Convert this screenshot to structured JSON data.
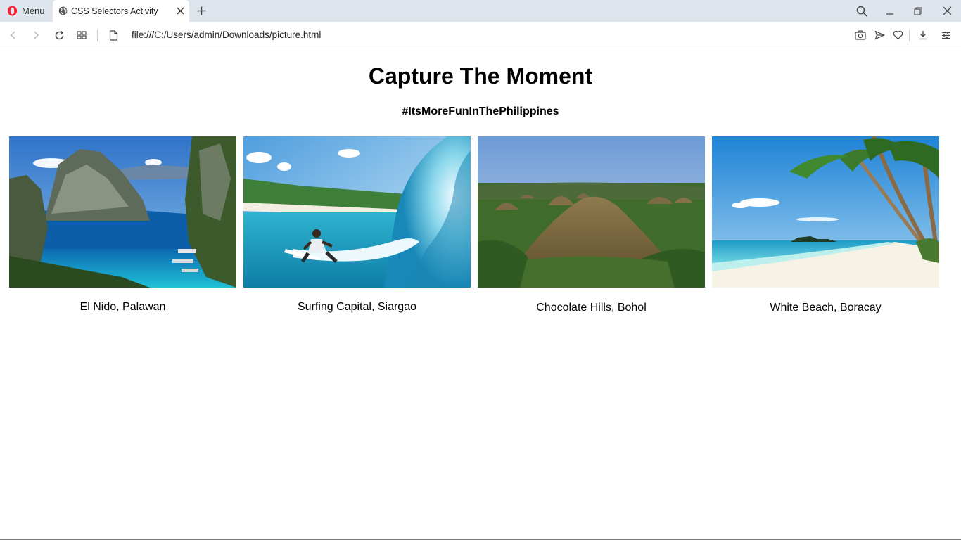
{
  "browser": {
    "menu_label": "Menu",
    "tab_title": "CSS Selectors Activity",
    "url": "file:///C:/Users/admin/Downloads/picture.html"
  },
  "page": {
    "title": "Capture The Moment",
    "subtitle": "#ItsMoreFunInThePhilippines",
    "gallery": [
      {
        "caption": "El Nido, Palawan"
      },
      {
        "caption": "Surfing Capital, Siargao"
      },
      {
        "caption": "Chocolate Hills, Bohol"
      },
      {
        "caption": "White Beach, Boracay"
      }
    ]
  },
  "colors": {
    "tabstrip_bg": "#dfe5ec",
    "opera_red": "#ff1b2d",
    "icon_gray": "#555555"
  },
  "icons": [
    "opera-logo-icon",
    "globe-icon",
    "close-icon",
    "plus-icon",
    "search-icon",
    "minimize-icon",
    "restore-icon",
    "back-icon",
    "forward-icon",
    "reload-icon",
    "grid-icon",
    "page-icon",
    "camera-icon",
    "send-icon",
    "heart-icon",
    "download-icon",
    "settings-icon"
  ]
}
